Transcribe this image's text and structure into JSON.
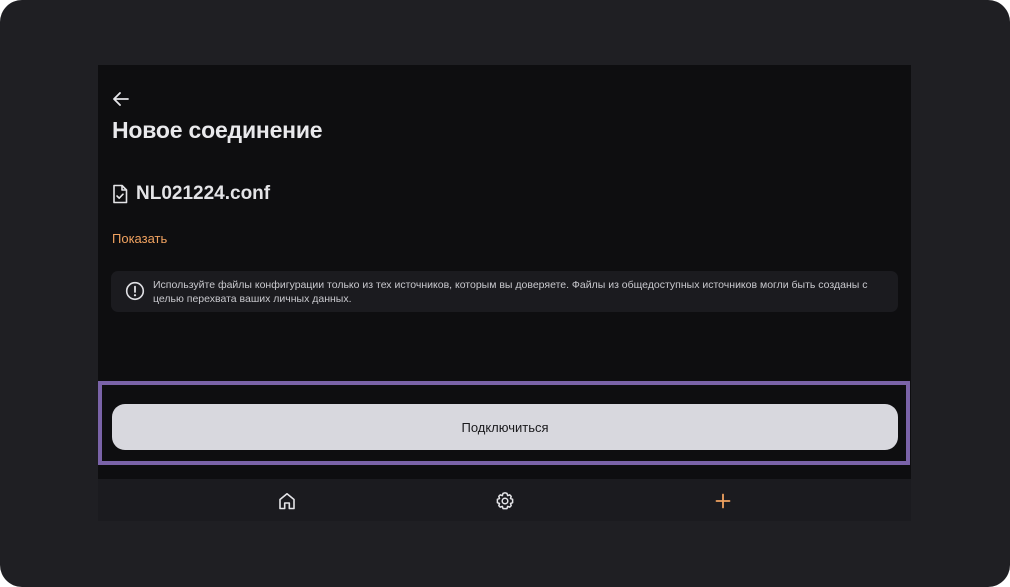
{
  "screen": {
    "title": "Новое соединение",
    "file_name": "NL021224.conf",
    "show_link": "Показать",
    "warning_text": "Используйте файлы конфигурации только из тех источников, которым вы доверяете. Файлы из общедоступных источников могли быть созданы с целью перехвата ваших личных данных.",
    "connect_button": "Подключиться"
  },
  "icons": {
    "back": "arrow-left-icon",
    "file": "file-check-icon",
    "warning": "info-circle-icon"
  },
  "bottom_nav": {
    "items": [
      {
        "name": "home",
        "icon": "home-icon"
      },
      {
        "name": "settings",
        "icon": "gear-icon"
      },
      {
        "name": "add",
        "icon": "plus-icon",
        "color": "#f0a260"
      }
    ]
  },
  "colors": {
    "accent": "#f0a260",
    "highlight": "#7a63a8",
    "background": "#0e0e10",
    "frame": "#1f1f23"
  }
}
